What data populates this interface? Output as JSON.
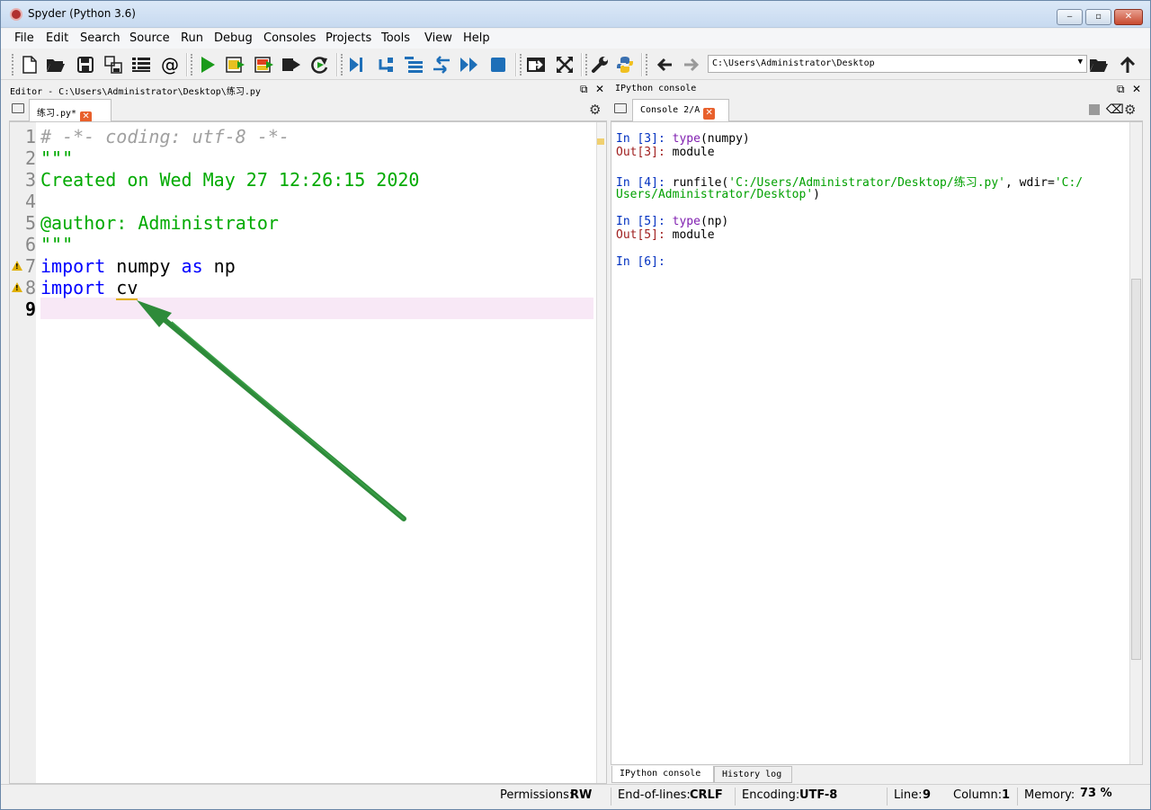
{
  "window": {
    "title": "Spyder (Python 3.6)",
    "min": "‒",
    "max": "▫",
    "close": "✕"
  },
  "menu": [
    "File",
    "Edit",
    "Search",
    "Source",
    "Run",
    "Debug",
    "Consoles",
    "Projects",
    "Tools",
    "View",
    "Help"
  ],
  "toolbar": {
    "path": "C:\\Users\\Administrator\\Desktop",
    "icons": [
      "new-file-icon",
      "open-folder-icon",
      "save-icon",
      "save-all-icon",
      "list-icon",
      "at-icon",
      "run-icon",
      "run-cell-icon",
      "run-cell-advance-icon",
      "run-selection-icon",
      "rerun-icon",
      "debug-icon",
      "step-icon",
      "step-into-icon",
      "step-return-icon",
      "continue-icon",
      "stop-icon",
      "maximize-pane-icon",
      "fullscreen-icon",
      "wrench-icon",
      "python-icon",
      "back-arrow-icon",
      "forward-arrow-icon",
      "browse-folder-icon",
      "parent-dir-icon"
    ]
  },
  "editor": {
    "header": "Editor - C:\\Users\\Administrator\\Desktop\\练习.py",
    "tab": "练习.py*",
    "lines": [
      {
        "n": "1",
        "text": "# -*- coding: utf-8 -*-"
      },
      {
        "n": "2",
        "text": "\"\"\""
      },
      {
        "n": "3",
        "text": "Created on Wed May 27 12:26:15 2020"
      },
      {
        "n": "4",
        "text": ""
      },
      {
        "n": "5",
        "text": "@author: Administrator"
      },
      {
        "n": "6",
        "text": "\"\"\""
      },
      {
        "n": "7",
        "kw1": "import",
        "rest1": " numpy ",
        "kw2": "as",
        "rest2": " np"
      },
      {
        "n": "8",
        "kw1": "import",
        "rest1": " ",
        "under": "cv"
      },
      {
        "n": "9",
        "text": ""
      }
    ]
  },
  "console": {
    "header": "IPython console",
    "tab": "Console 2/A",
    "in3": "In [3]: ",
    "in3_fn": "type",
    "in3_rest": "(numpy)",
    "out3": "Out[3]: ",
    "out3_val": "module",
    "in4": "In [4]: ",
    "in4_a": "runfile(",
    "in4_s1": "'C:/Users/Administrator/Desktop/练习.py'",
    "in4_b": ", wdir=",
    "in4_s2a": "'C:/",
    "in4_s2b": "Users/Administrator/Desktop'",
    "in4_c": ")",
    "in5": "In [5]: ",
    "in5_fn": "type",
    "in5_rest": "(np)",
    "out5": "Out[5]: ",
    "out5_val": "module",
    "in6": "In [6]: ",
    "bottom_tabs": [
      "IPython console",
      "History log"
    ]
  },
  "status": {
    "permissions_label": "Permissions:",
    "permissions": "RW",
    "eol_label": "End-of-lines:",
    "eol": "CRLF",
    "encoding_label": "Encoding:",
    "encoding": "UTF-8",
    "line_label": "Line:",
    "line": "9",
    "column_label": "Column:",
    "column": "1",
    "memory_label": "Memory:",
    "memory": "73 %"
  },
  "colors": {
    "annotation_arrow": "#2e8b3a",
    "current_line": "#f8e8f6"
  }
}
